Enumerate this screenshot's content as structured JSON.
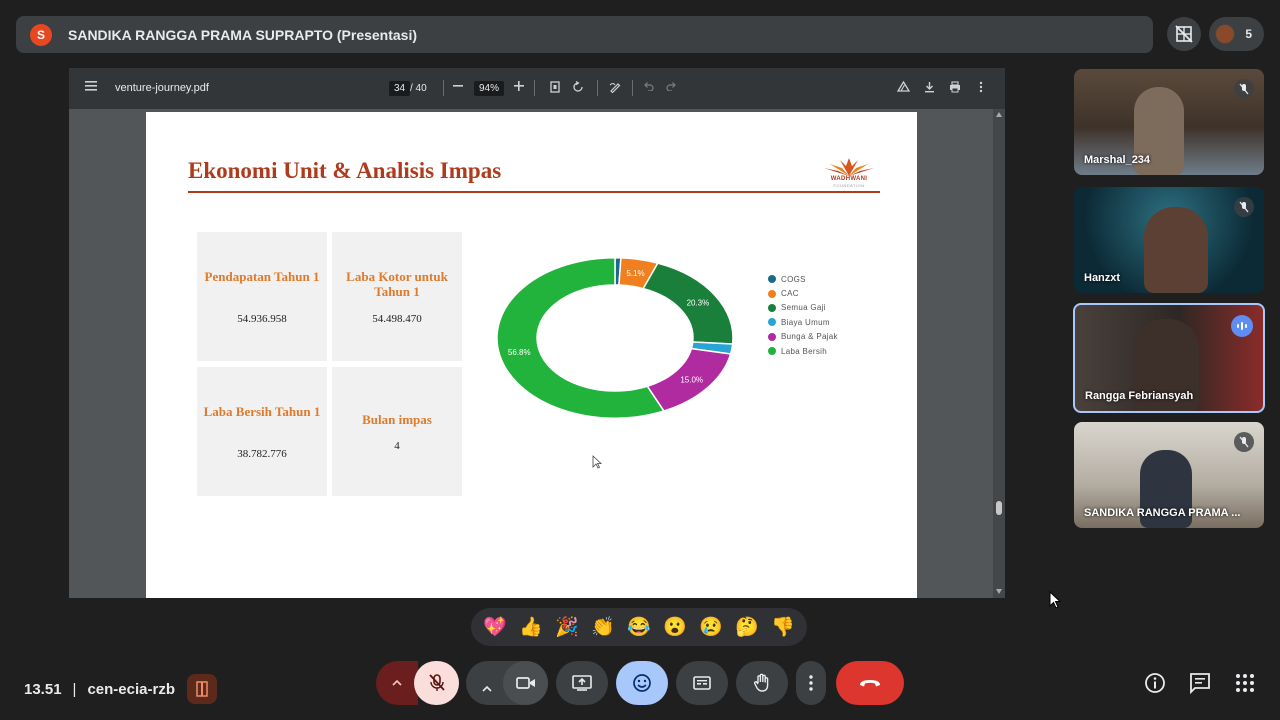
{
  "top_bar": {
    "avatar_letter": "S",
    "presenter_title": "SANDIKA RANGGA PRAMA SUPRAPTO (Presentasi)",
    "participant_count": "5"
  },
  "pdf_viewer": {
    "filename": "venture-journey.pdf",
    "current_page": "34",
    "total_pages": "/ 40",
    "zoom": "94%"
  },
  "slide": {
    "title": "Ekonomi Unit & Analisis Impas",
    "logo_text": "WADHWANI",
    "logo_subtext": "FOUNDATION",
    "cards": [
      {
        "label": "Pendapatan Tahun 1",
        "value": "54.936.958"
      },
      {
        "label": "Laba Kotor untuk Tahun 1",
        "value": "54.498.470"
      },
      {
        "label": "Laba Bersih Tahun 1",
        "value": "38.782.776"
      },
      {
        "label": "Bulan impas",
        "value": "4"
      }
    ]
  },
  "chart_data": {
    "type": "pie",
    "donut": true,
    "title": "",
    "categories": [
      "COGS",
      "CAC",
      "Semua Gaji",
      "Biaya Umum",
      "Bunga & Pajak",
      "Laba Bersih"
    ],
    "values": [
      0.8,
      5.1,
      20.3,
      2.0,
      15.0,
      56.8
    ],
    "data_labels": [
      "",
      "5.1%",
      "20.3%",
      "",
      "15.0%",
      "56.8%"
    ],
    "colors": [
      "#1b6a8a",
      "#f07f1f",
      "#1a7f3a",
      "#27a6d6",
      "#b02aa0",
      "#22b33c"
    ],
    "legend_position": "right"
  },
  "participants": [
    {
      "name": "Marshal_234",
      "muted": true
    },
    {
      "name": "Hanzxt",
      "muted": true
    },
    {
      "name": "Rangga Febriansyah",
      "muted": false,
      "speaking": true
    },
    {
      "name": "SANDIKA RANGGA PRAMA ...",
      "muted": true
    }
  ],
  "reactions": [
    "💖",
    "👍",
    "🎉",
    "👏",
    "😂",
    "😮",
    "😢",
    "🤔",
    "👎"
  ],
  "bottom_bar": {
    "time": "13.51",
    "separator": "|",
    "meeting_code": "cen-ecia-rzb"
  }
}
